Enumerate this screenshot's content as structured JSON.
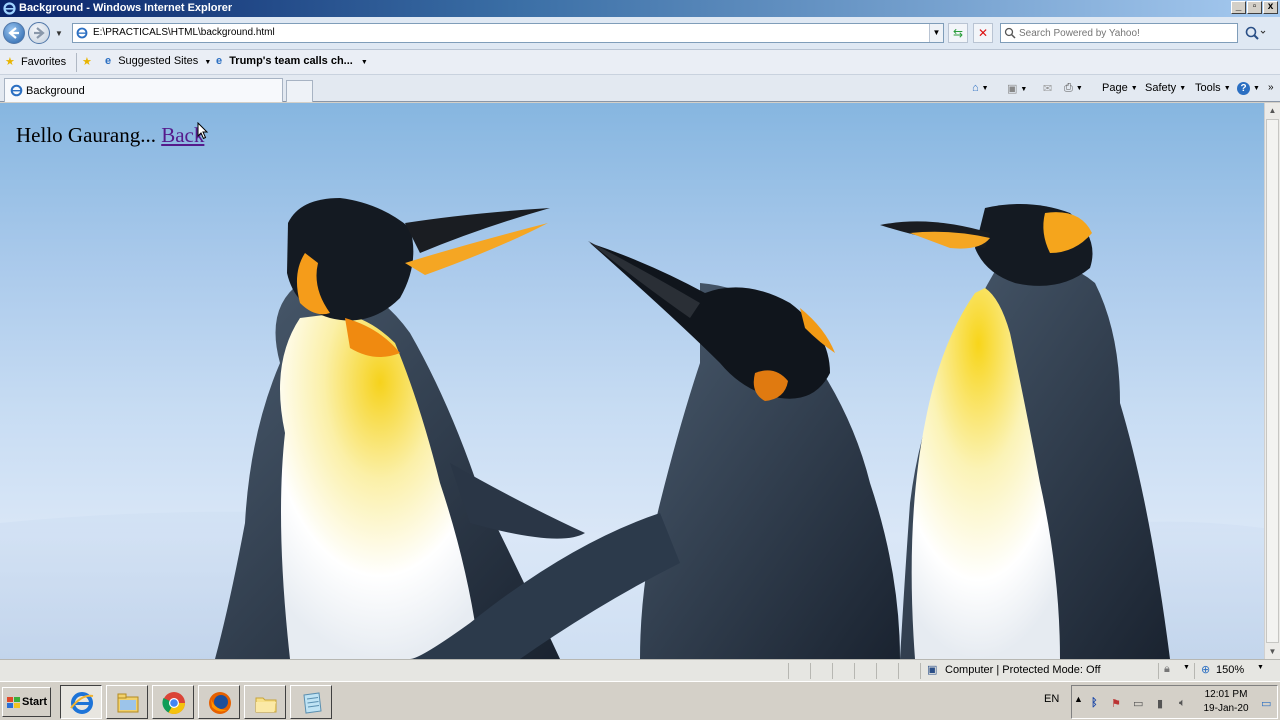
{
  "window": {
    "title": "Background - Windows Internet Explorer",
    "minimize_label": "_",
    "maximize_label": "▫",
    "close_label": "x"
  },
  "address_bar": {
    "url": "E:\\PRACTICALS\\HTML\\background.html",
    "search_placeholder": "Search Powered by Yahoo!"
  },
  "favorites_bar": {
    "favorites_label": "Favorites",
    "suggested_sites_label": "Suggested Sites",
    "news_link_label": "Trump's team calls ch..."
  },
  "tabs": [
    {
      "label": "Background",
      "active": true
    }
  ],
  "command_bar": {
    "page_label": "Page",
    "safety_label": "Safety",
    "tools_label": "Tools"
  },
  "page": {
    "greeting": "Hello Gaurang...",
    "back_link": "Back",
    "link_color": "#551a8b"
  },
  "status_bar": {
    "zone_text": "Computer | Protected Mode: Off",
    "zoom": "150%"
  },
  "taskbar": {
    "start_label": "Start",
    "apps": [
      "internet-explorer",
      "file-explorer",
      "chrome",
      "firefox",
      "folder",
      "notepad"
    ],
    "language": "EN",
    "time": "12:01 PM",
    "date": "19-Jan-20"
  },
  "colors": {
    "title_bar": "#0a246a",
    "sky_top": "#86b6e0",
    "sky_bottom": "#dae7f7",
    "beak_orange": "#f5a623"
  }
}
